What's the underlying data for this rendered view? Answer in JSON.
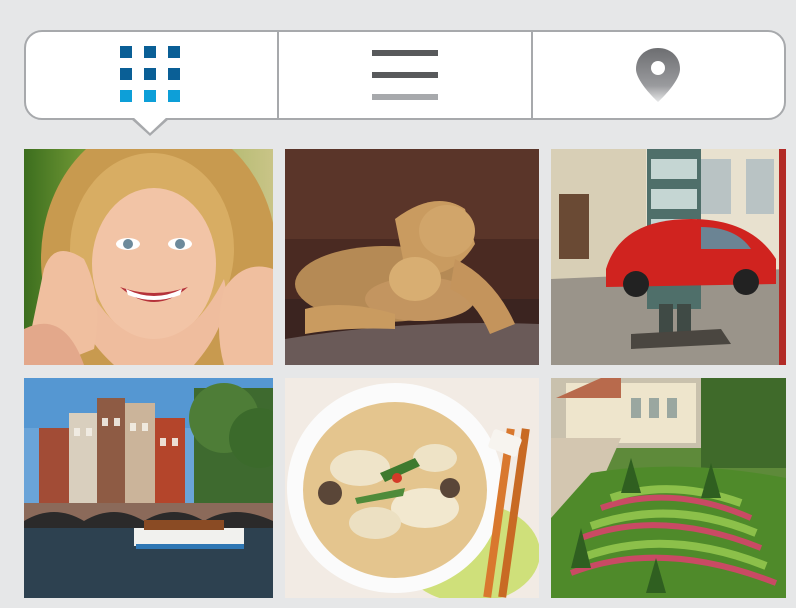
{
  "colors": {
    "background": "#e6e7e8",
    "control_border": "#a7a9ac",
    "grid_icon_dark": "#0a5f96",
    "grid_icon_light": "#0d9fd8",
    "list_icon_dark": "#58595b",
    "list_icon_light": "#a7a9ac",
    "pin_icon": "#808285"
  },
  "view_switcher": {
    "selected": "grid",
    "tabs": [
      {
        "id": "grid",
        "icon": "grid-icon"
      },
      {
        "id": "list",
        "icon": "list-icon"
      },
      {
        "id": "map",
        "icon": "map-pin-icon"
      }
    ]
  },
  "photos": [
    {
      "icon": "photo-girl-smiling"
    },
    {
      "icon": "photo-lioness-and-cub"
    },
    {
      "icon": "photo-red-beetle-car"
    },
    {
      "icon": "photo-canal-houses"
    },
    {
      "icon": "photo-noodle-soup"
    },
    {
      "icon": "photo-formal-garden"
    }
  ]
}
